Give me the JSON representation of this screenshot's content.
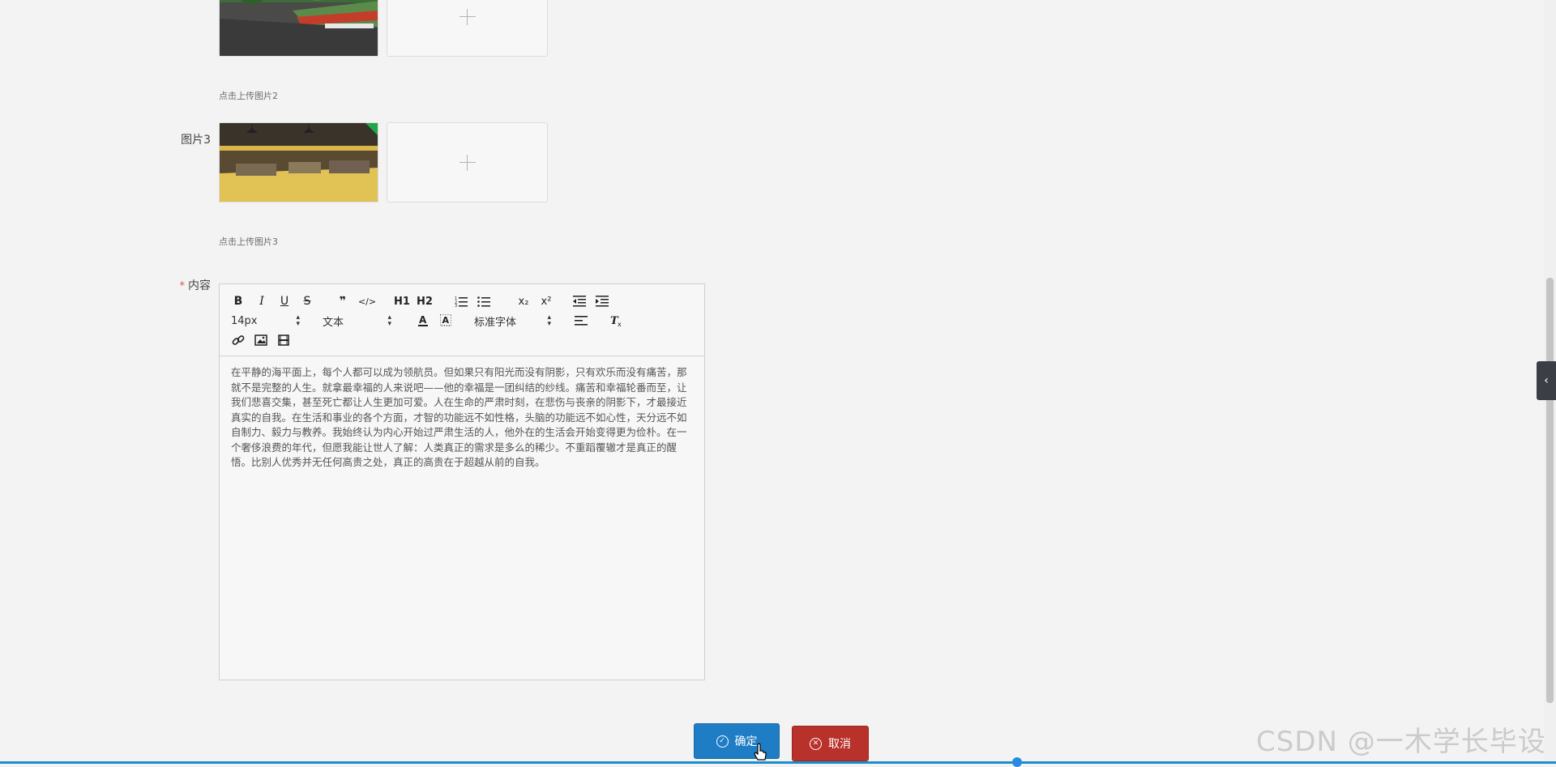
{
  "form": {
    "image2": {
      "hint": "点击上传图片2"
    },
    "image3": {
      "label": "图片3",
      "hint": "点击上传图片3"
    },
    "content": {
      "required_mark": "*",
      "label": "内容",
      "text": "在平静的海平面上，每个人都可以成为领航员。但如果只有阳光而没有阴影，只有欢乐而没有痛苦，那就不是完整的人生。就拿最幸福的人来说吧——他的幸福是一团纠结的纱线。痛苦和幸福轮番而至，让我们悲喜交集，甚至死亡都让人生更加可爱。人在生命的严肃时刻，在悲伤与丧亲的阴影下，才最接近真实的自我。在生活和事业的各个方面，才智的功能远不如性格，头脑的功能远不如心性，天分远不如自制力、毅力与教养。我始终认为内心开始过严肃生活的人，他外在的生活会开始变得更为俭朴。在一个奢侈浪费的年代，但愿我能让世人了解：人类真正的需求是多么的稀少。不重蹈覆辙才是真正的醒悟。比别人优秀并无任何高贵之处，真正的高贵在于超越从前的自我。"
    }
  },
  "toolbar": {
    "bold": "B",
    "italic": "I",
    "underline": "U",
    "strike": "S",
    "blockquote": "❞",
    "code": "</>",
    "h1": "H1",
    "h2": "H2",
    "subscript": "x₂",
    "superscript": "x²",
    "size_value": "14px",
    "header_value": "文本",
    "font_value": "标准字体"
  },
  "buttons": {
    "ok": "确定",
    "cancel": "取消"
  },
  "watermark": "CSDN @一木学长毕设",
  "side_tab": "‹"
}
